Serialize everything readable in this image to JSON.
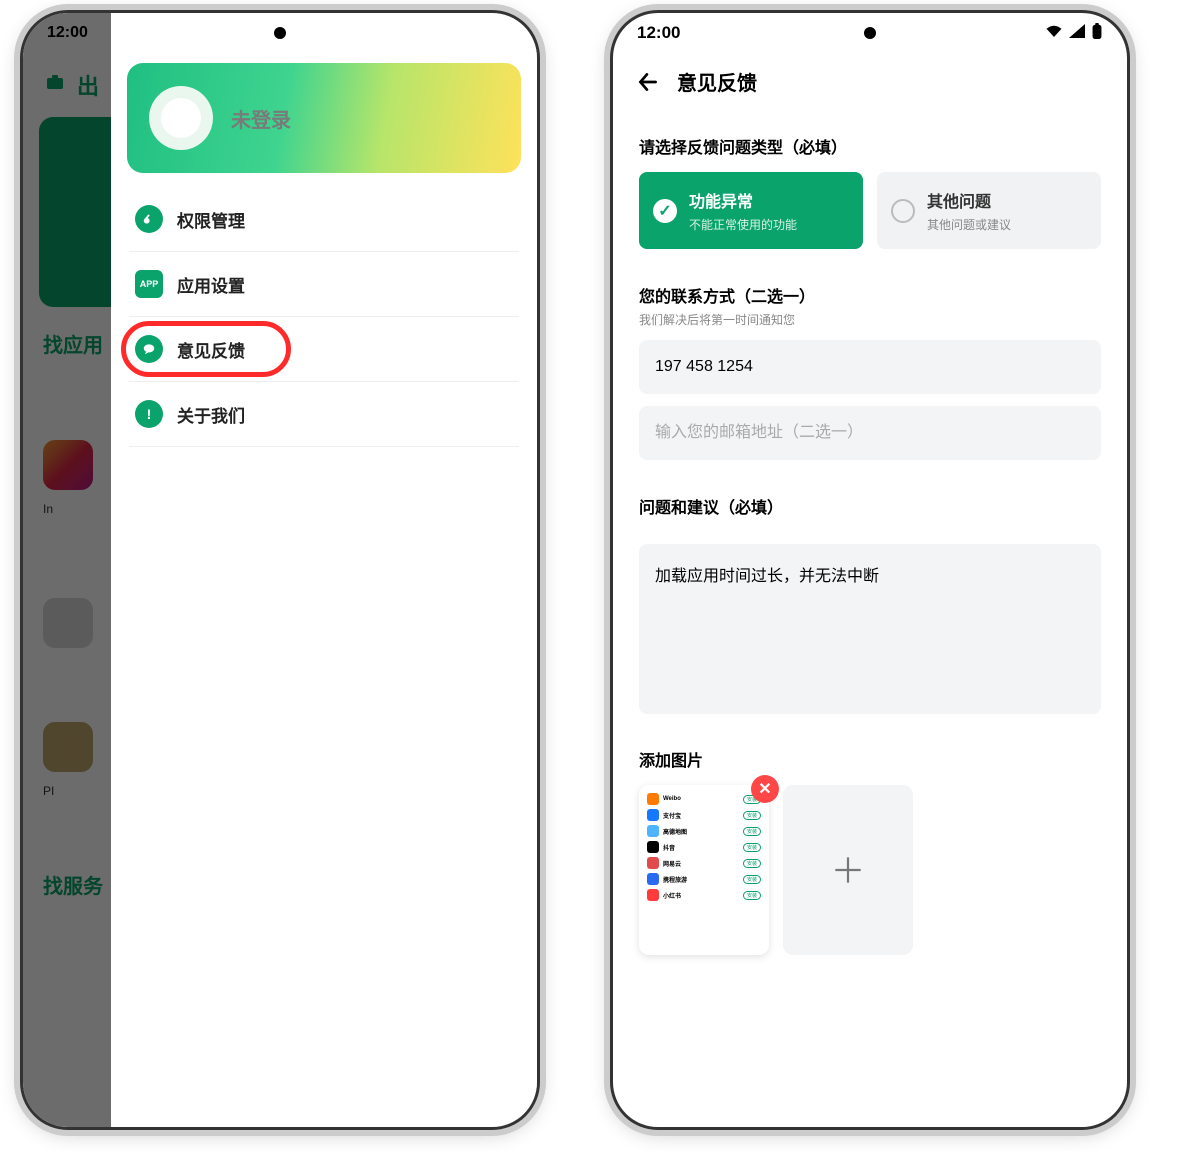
{
  "left": {
    "status_time": "12:00",
    "bg_nav_label": "出",
    "bg_section1": "找应用",
    "bg_section2": "找服务",
    "bg_tile_label1": "In",
    "bg_tile_label2": "PI",
    "profile_status": "未登录",
    "menu": [
      {
        "label": "权限管理",
        "icon": "key-icon"
      },
      {
        "label": "应用设置",
        "icon": "app-icon"
      },
      {
        "label": "意见反馈",
        "icon": "chat-icon",
        "highlighted": true
      },
      {
        "label": "关于我们",
        "icon": "info-icon"
      }
    ]
  },
  "right": {
    "status_time": "12:00",
    "page_title": "意见反馈",
    "type_header": "请选择反馈问题类型（必填）",
    "types": [
      {
        "title": "功能异常",
        "sub": "不能正常使用的功能",
        "selected": true
      },
      {
        "title": "其他问题",
        "sub": "其他问题或建议",
        "selected": false
      }
    ],
    "contact_header": "您的联系方式（二选一）",
    "contact_sub": "我们解决后将第一时间通知您",
    "phone_value": "197 458 1254",
    "email_placeholder": "输入您的邮箱地址（二选一）",
    "issue_header": "问题和建议（必填）",
    "issue_value": "加载应用时间过长，并无法中断",
    "attach_header": "添加图片",
    "thumb_apps": [
      {
        "name": "Weibo",
        "color": "#ff7a00"
      },
      {
        "name": "支付宝",
        "color": "#1677ff"
      },
      {
        "name": "高德地图",
        "color": "#4fb4ff"
      },
      {
        "name": "抖音",
        "color": "#000"
      },
      {
        "name": "网易云",
        "color": "#e24b4b"
      },
      {
        "name": "携程旅游",
        "color": "#2a6af0"
      },
      {
        "name": "小红书",
        "color": "#ff3b3b"
      }
    ],
    "thumb_pill": "安装"
  }
}
